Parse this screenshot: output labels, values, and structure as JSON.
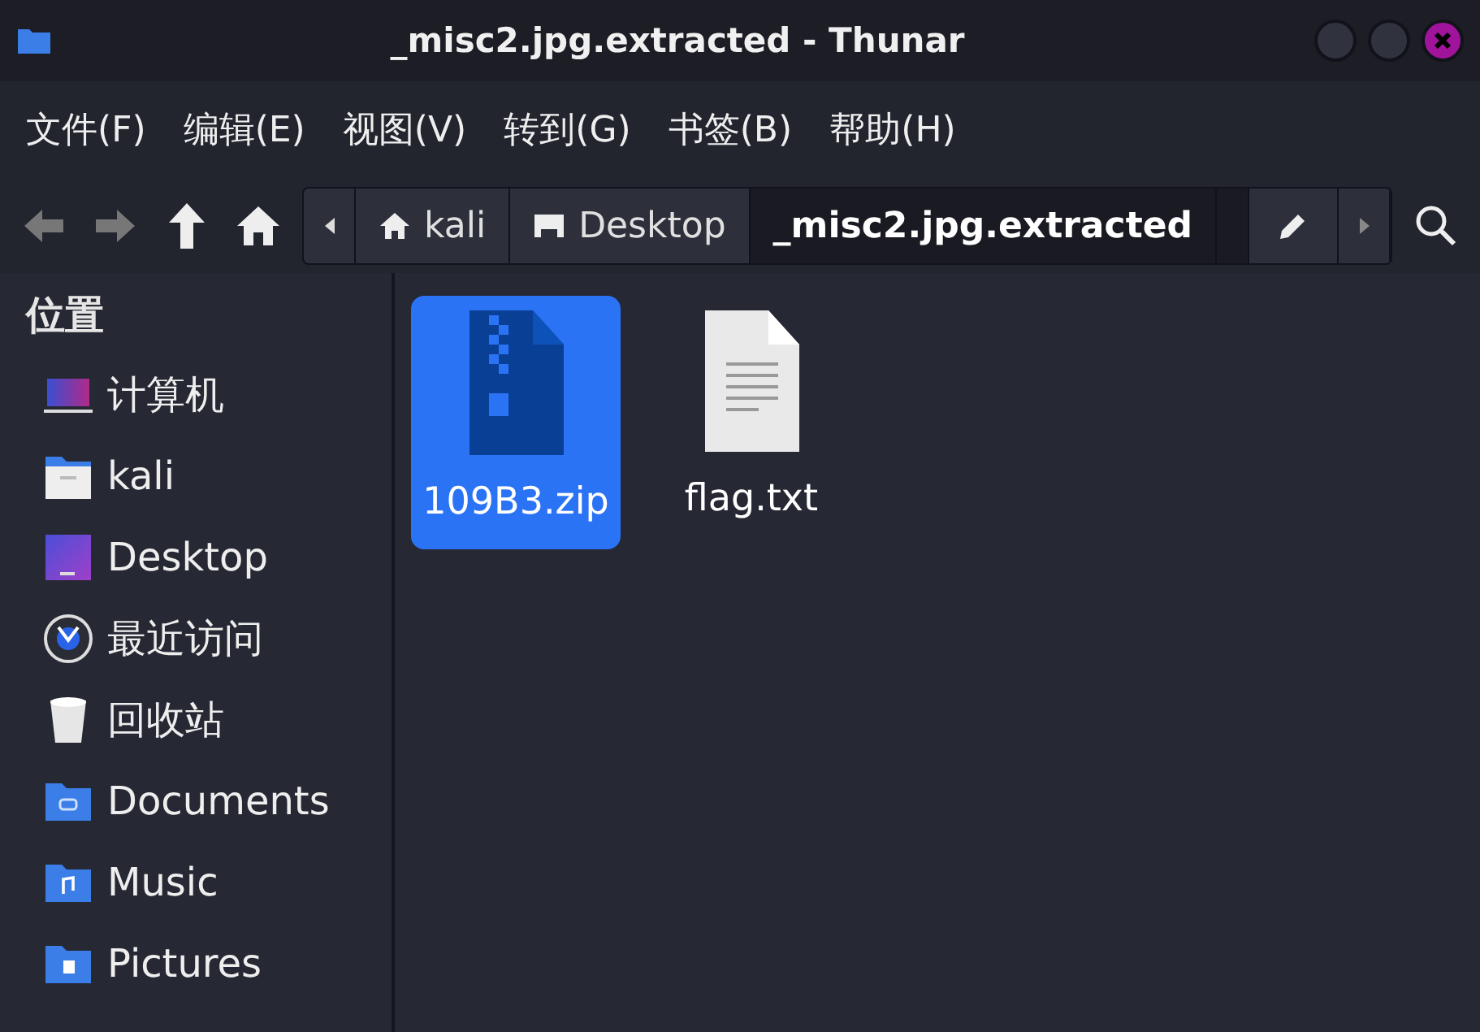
{
  "window": {
    "title": "_misc2.jpg.extracted - Thunar"
  },
  "menu": [
    "文件(F)",
    "编辑(E)",
    "视图(V)",
    "转到(G)",
    "书签(B)",
    "帮助(H)"
  ],
  "path": [
    {
      "label": "kali",
      "kind": "home",
      "selected": false
    },
    {
      "label": "Desktop",
      "kind": "desktop",
      "selected": false
    },
    {
      "label": "_misc2.jpg.extracted",
      "kind": "folder",
      "selected": true
    }
  ],
  "sidebar": {
    "heading": "位置",
    "items": [
      {
        "label": "计算机",
        "kind": "computer"
      },
      {
        "label": "kali",
        "kind": "home"
      },
      {
        "label": "Desktop",
        "kind": "desktop"
      },
      {
        "label": "最近访问",
        "kind": "recent"
      },
      {
        "label": "回收站",
        "kind": "trash"
      },
      {
        "label": "Documents",
        "kind": "documents"
      },
      {
        "label": "Music",
        "kind": "music"
      },
      {
        "label": "Pictures",
        "kind": "pictures"
      }
    ]
  },
  "files": [
    {
      "name": "109B3.zip",
      "kind": "zip",
      "selected": true
    },
    {
      "name": "flag.txt",
      "kind": "text",
      "selected": false
    }
  ]
}
